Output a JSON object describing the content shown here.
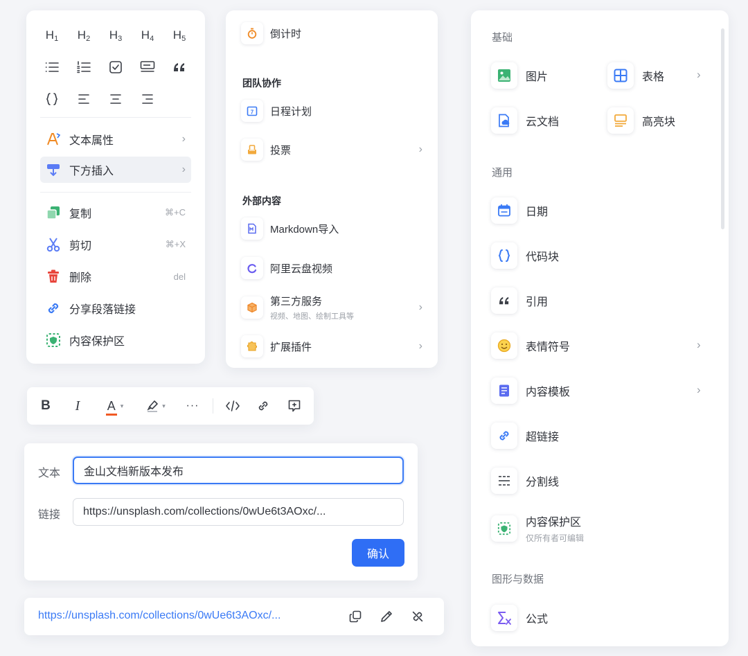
{
  "block_menu": {
    "headings": [
      "H1",
      "H2",
      "H3",
      "H4",
      "H5"
    ],
    "format_icons": [
      "bullet-list-icon",
      "ordered-list-icon",
      "checkbox-icon",
      "callout-icon",
      "quote-icon",
      "code-braces-icon",
      "align-left-icon",
      "align-center-icon",
      "align-right-icon"
    ],
    "items": [
      {
        "label": "文本属性",
        "icon": "text-style-icon",
        "has_submenu": true
      },
      {
        "label": "下方插入",
        "icon": "insert-below-icon",
        "has_submenu": true
      },
      {
        "label": "复制",
        "icon": "copy-icon",
        "shortcut": "⌘+C"
      },
      {
        "label": "剪切",
        "icon": "scissors-icon",
        "shortcut": "⌘+X"
      },
      {
        "label": "删除",
        "icon": "trash-icon",
        "shortcut": "del"
      },
      {
        "label": "分享段落链接",
        "icon": "link-icon"
      },
      {
        "label": "内容保护区",
        "icon": "shield-icon"
      }
    ]
  },
  "insert_list": {
    "top_item": {
      "label": "倒计时",
      "icon": "stopwatch-icon"
    },
    "sections": [
      {
        "title": "团队协作",
        "items": [
          {
            "label": "日程计划",
            "icon": "calendar-icon"
          },
          {
            "label": "投票",
            "icon": "ballot-box-icon",
            "has_submenu": true
          }
        ]
      },
      {
        "title": "外部内容",
        "items": [
          {
            "label": "Markdown导入",
            "icon": "markdown-file-icon"
          },
          {
            "label": "阿里云盘视频",
            "icon": "aliyun-drive-icon"
          },
          {
            "label": "第三方服务",
            "sub": "视频、地图、绘制工具等",
            "icon": "cube-icon",
            "has_submenu": true
          },
          {
            "label": "扩展插件",
            "icon": "plugin-icon",
            "has_submenu": true
          }
        ]
      }
    ]
  },
  "insert_panel": {
    "sections": [
      {
        "title": "基础",
        "items": [
          {
            "label": "图片",
            "icon": "image-icon"
          },
          {
            "label": "表格",
            "icon": "table-icon",
            "has_submenu": true
          },
          {
            "label": "云文档",
            "icon": "cloud-doc-icon"
          },
          {
            "label": "高亮块",
            "icon": "highlight-block-icon"
          }
        ]
      },
      {
        "title": "通用",
        "items": [
          {
            "label": "日期",
            "icon": "date-icon"
          },
          {
            "label": "代码块",
            "icon": "code-block-icon"
          },
          {
            "label": "引用",
            "icon": "quote-icon"
          },
          {
            "label": "表情符号",
            "icon": "emoji-icon",
            "has_submenu": true
          },
          {
            "label": "内容模板",
            "icon": "template-icon",
            "has_submenu": true
          },
          {
            "label": "超链接",
            "icon": "hyperlink-icon"
          },
          {
            "label": "分割线",
            "icon": "divider-icon"
          },
          {
            "label": "内容保护区",
            "sub": "仅所有者可编辑",
            "icon": "protected-area-icon"
          }
        ]
      },
      {
        "title": "图形与数据",
        "items": [
          {
            "label": "公式",
            "icon": "formula-icon"
          }
        ]
      }
    ]
  },
  "toolbar": {
    "buttons": [
      "bold-icon",
      "italic-icon",
      "font-color-icon",
      "highlight-pen-icon",
      "more-icon",
      "code-icon",
      "link-icon",
      "comment-icon"
    ],
    "text": {
      "bold": "B",
      "italic": "I",
      "font_color": "A",
      "more": "···"
    },
    "font_color_underline": "#f05a24"
  },
  "link_form": {
    "text_label": "文本",
    "text_value": "金山文档新版本发布",
    "link_label": "链接",
    "link_value": "https://unsplash.com/collections/0wUe6t3AOxc/...",
    "confirm": "确认"
  },
  "link_bar": {
    "url": "https://unsplash.com/collections/0wUe6t3AOxc/...",
    "actions": [
      "copy-link-icon",
      "edit-link-icon",
      "unlink-icon"
    ]
  },
  "colors": {
    "accent": "#2f6ef5",
    "link": "#3a7af5",
    "green": "#3bb273",
    "orange": "#f08a24",
    "red": "#e8453c",
    "purple": "#7b5cf0"
  }
}
